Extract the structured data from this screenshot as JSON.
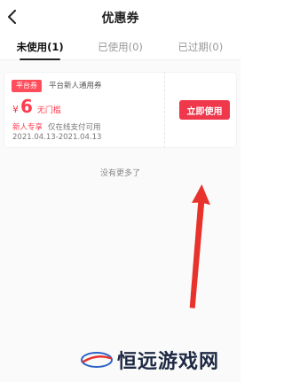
{
  "header": {
    "title": "优惠券",
    "back_icon": "chevron-left-icon"
  },
  "tabs": [
    {
      "label": "未使用(1)",
      "active": true
    },
    {
      "label": "已使用(0)",
      "active": false
    },
    {
      "label": "已过期(0)",
      "active": false
    }
  ],
  "coupon": {
    "tag": "平台券",
    "name": "平台新人通用券",
    "currency": "¥",
    "amount": "6",
    "threshold": "无门槛",
    "audience": "新人专享",
    "restriction": "仅在线支付可用",
    "validity": "2021.04.13-2021.04.13",
    "action_label": "立即使用"
  },
  "footer_text": "没有更多了",
  "watermark": {
    "text": "恒远游戏网"
  },
  "colors": {
    "accent": "#f0384d",
    "price_red": "#ff3b4d",
    "annotation_arrow": "#e8322c"
  }
}
